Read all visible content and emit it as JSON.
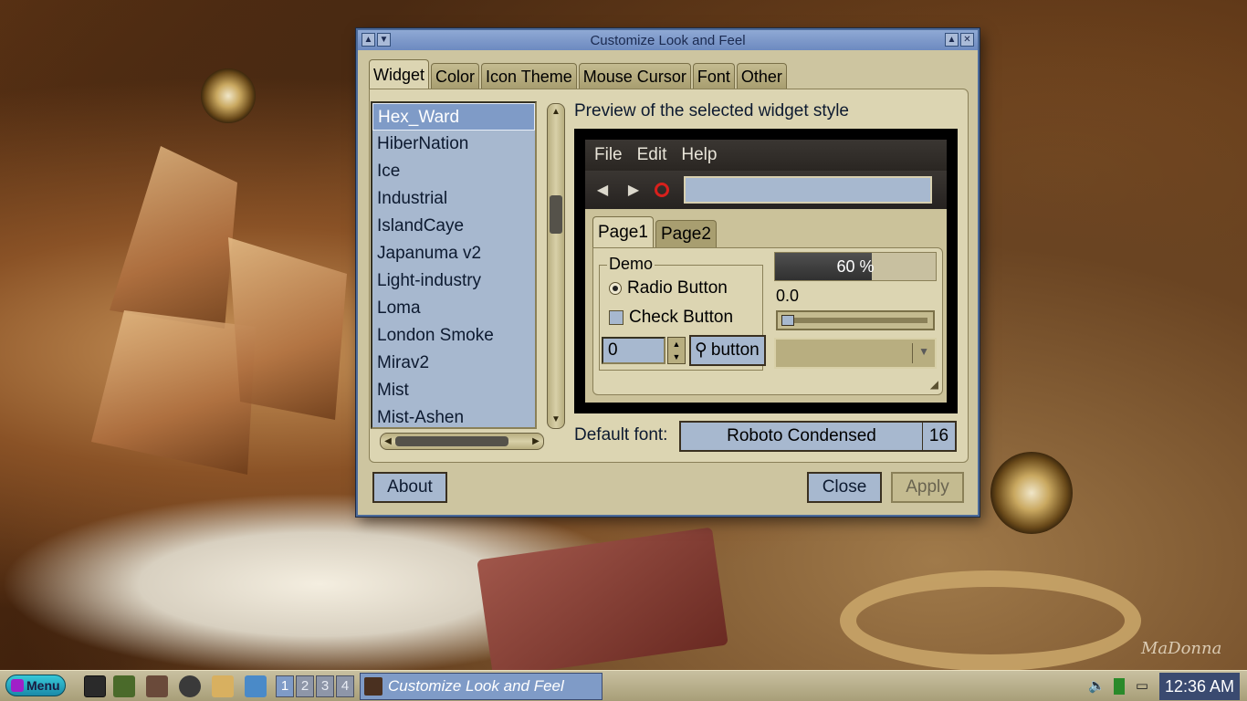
{
  "window": {
    "title": "Customize Look and Feel"
  },
  "tabs": [
    "Widget",
    "Color",
    "Icon Theme",
    "Mouse Cursor",
    "Font",
    "Other"
  ],
  "theme_list": {
    "items": [
      "Hex_Ward",
      "HiberNation",
      "Ice",
      "Industrial",
      "IslandCaye",
      "Japanuma v2",
      "Light-industry",
      "Loma",
      "London Smoke",
      "Mirav2",
      "Mist",
      "Mist-Ashen"
    ],
    "selected": "Hex_Ward"
  },
  "preview": {
    "title": "Preview of the selected widget style",
    "menus": [
      "File",
      "Edit",
      "Help"
    ],
    "tabs": [
      "Page1",
      "Page2"
    ],
    "demo_label": "Demo",
    "radio_label": "Radio Button",
    "check_label": "Check Button",
    "spin_value": "0",
    "button_label": "button",
    "progress_text": "60 %",
    "progress_fraction": 0.6,
    "scale_value": "0.0"
  },
  "font": {
    "label": "Default font:",
    "name": "Roboto Condensed",
    "size": "16"
  },
  "buttons": {
    "about": "About",
    "close": "Close",
    "apply": "Apply"
  },
  "taskbar": {
    "menu_label": "Menu",
    "workspaces": [
      "1",
      "2",
      "3",
      "4"
    ],
    "task_title": "Customize Look and Feel",
    "clock": "12:36 AM"
  },
  "wallpaper": {
    "signature": "MaDonna"
  },
  "colors": {
    "selection": "#7f9bc7",
    "window_bg": "#cdc5a0",
    "field_bg": "#a7b8cf",
    "titlebar": "#8fa9d4"
  }
}
